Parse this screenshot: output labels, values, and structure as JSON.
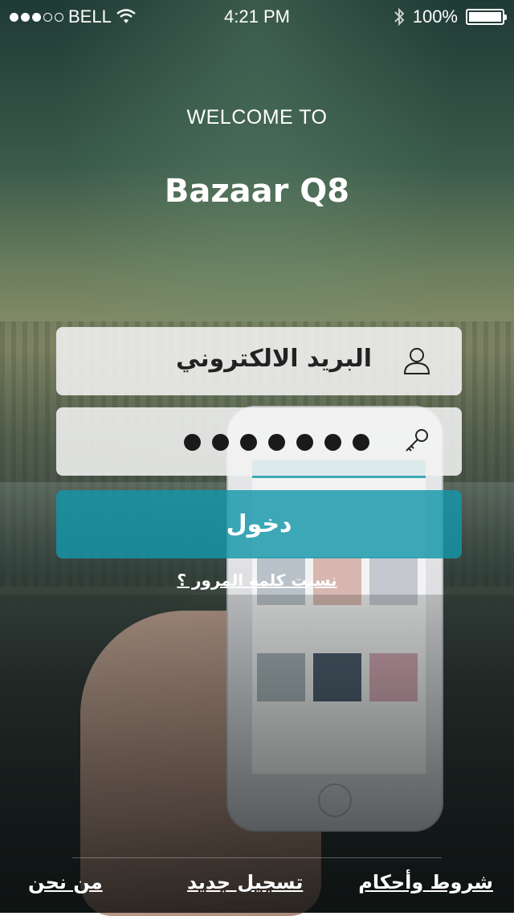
{
  "status_bar": {
    "carrier": "BELL",
    "time": "4:21 PM",
    "battery": "100%",
    "battery_level": 1.0,
    "signal_bars_filled": 3,
    "signal_bars_total": 5
  },
  "header": {
    "welcome": "WELCOME TO",
    "app_name": "Bazaar Q8"
  },
  "login_form": {
    "email_placeholder": "البريد الالكتروني",
    "password_mask_count": 7,
    "login_button": "دخول",
    "forgot_password": "نسيت كلمة المرور ؟"
  },
  "footer": {
    "about": "من نحن",
    "register": "تسجيل جديد",
    "terms": "شروط وأحكام"
  },
  "colors": {
    "login_button": "#1496aa",
    "field_background": "#f2f2f2"
  }
}
